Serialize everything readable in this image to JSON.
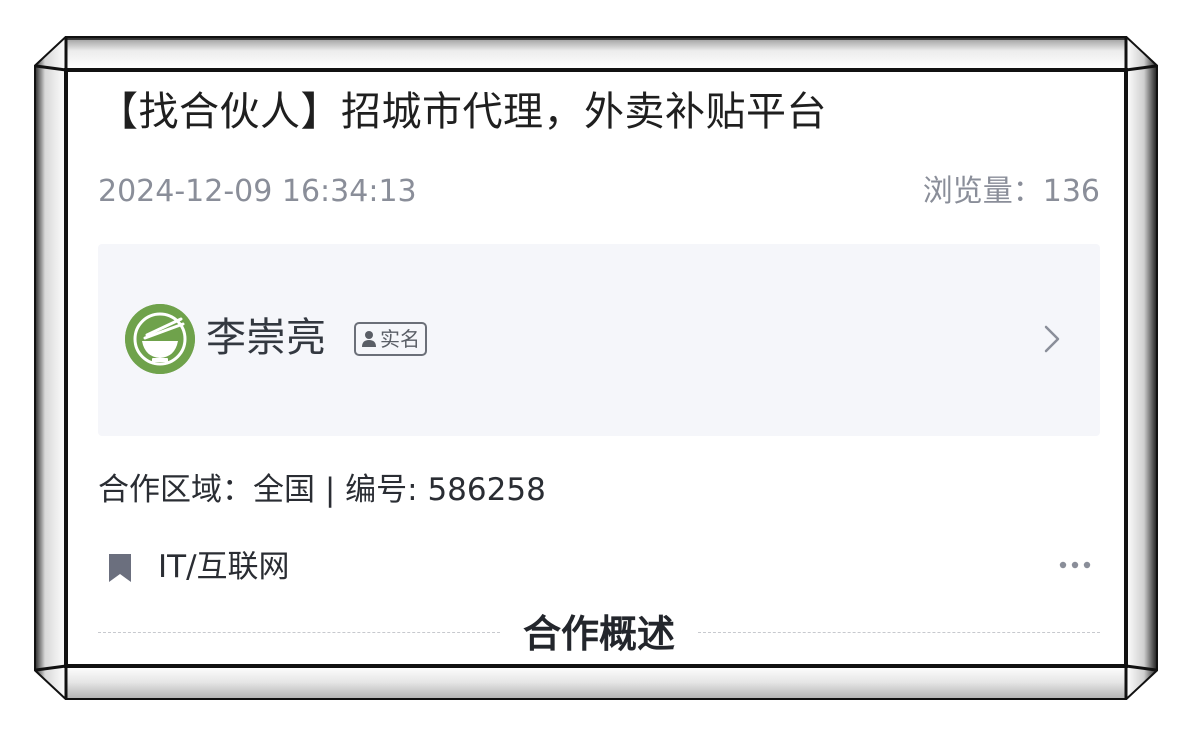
{
  "post": {
    "title": "【找合伙人】招城市代理，外卖补贴平台",
    "timestamp": "2024-12-09 16:34:13",
    "views_label": "浏览量：136"
  },
  "author": {
    "name": "李崇亮",
    "verified_label": "实名",
    "avatar_icon": "bowl-chopsticks-icon",
    "avatar_color": "#6fa24b"
  },
  "details": {
    "info_line": "合作区域：全国 | 编号: 586258",
    "category": "IT/互联网",
    "category_icon": "bookmark-icon"
  },
  "section": {
    "title": "合作概述"
  },
  "colors": {
    "text_primary": "#1f1f1f",
    "text_muted": "#8a8e99",
    "card_bg": "#f5f6fa",
    "accent_green": "#6fa24b"
  }
}
